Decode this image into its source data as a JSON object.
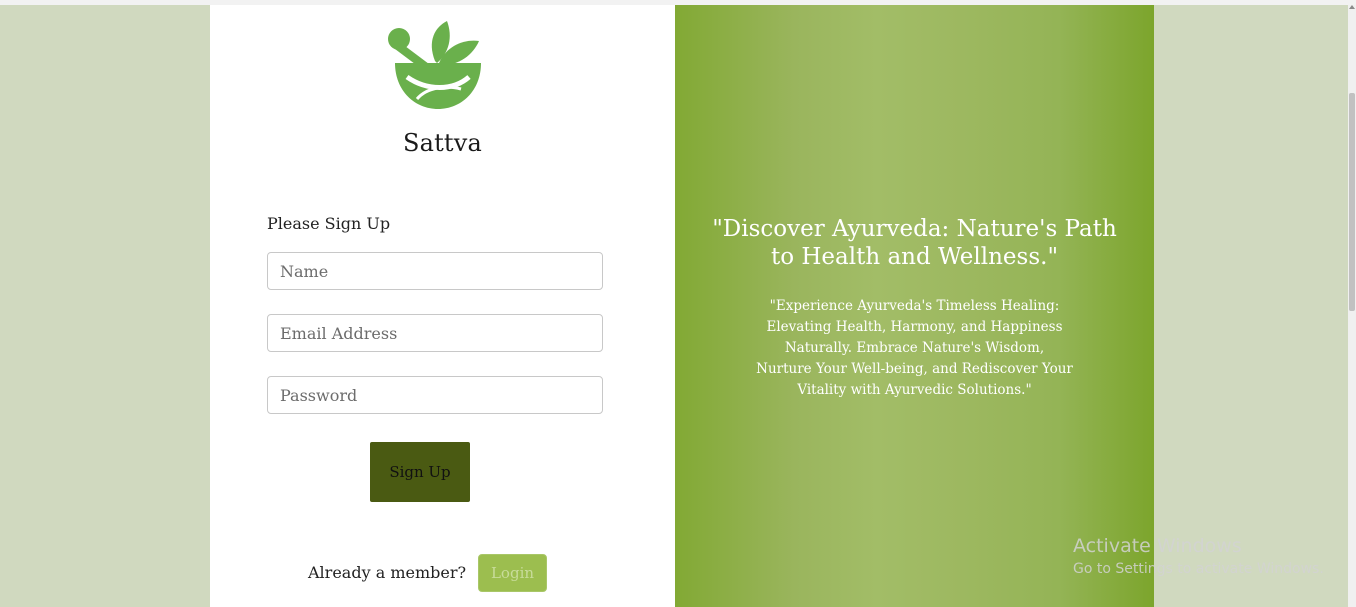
{
  "brand": {
    "name": "Sattva",
    "logo_icon": "mortar-pestle-leaf-icon",
    "logo_color": "#6ab04c"
  },
  "form": {
    "title": "Please Sign Up",
    "name_placeholder": "Name",
    "email_placeholder": "Email Address",
    "password_placeholder": "Password",
    "submit_label": "Sign Up",
    "member_prompt": "Already a member?",
    "login_label": "Login"
  },
  "hero": {
    "headline": "\"Discover Ayurveda: Nature's Path to Health and Wellness.\"",
    "body": "\"Experience Ayurveda's Timeless Healing: Elevating Health, Harmony, and Happiness Naturally. Embrace Nature's Wisdom, Nurture Your Well-being, and Rediscover Your Vitality with Ayurvedic Solutions.\""
  },
  "watermark": {
    "title": "Activate Windows",
    "subtitle": "Go to Settings to activate Windows."
  },
  "colors": {
    "accent_green": "#82a934",
    "button_dark": "#4a5a12",
    "login_button": "#9cbe4f",
    "page_bg": "#d0d9bf"
  }
}
